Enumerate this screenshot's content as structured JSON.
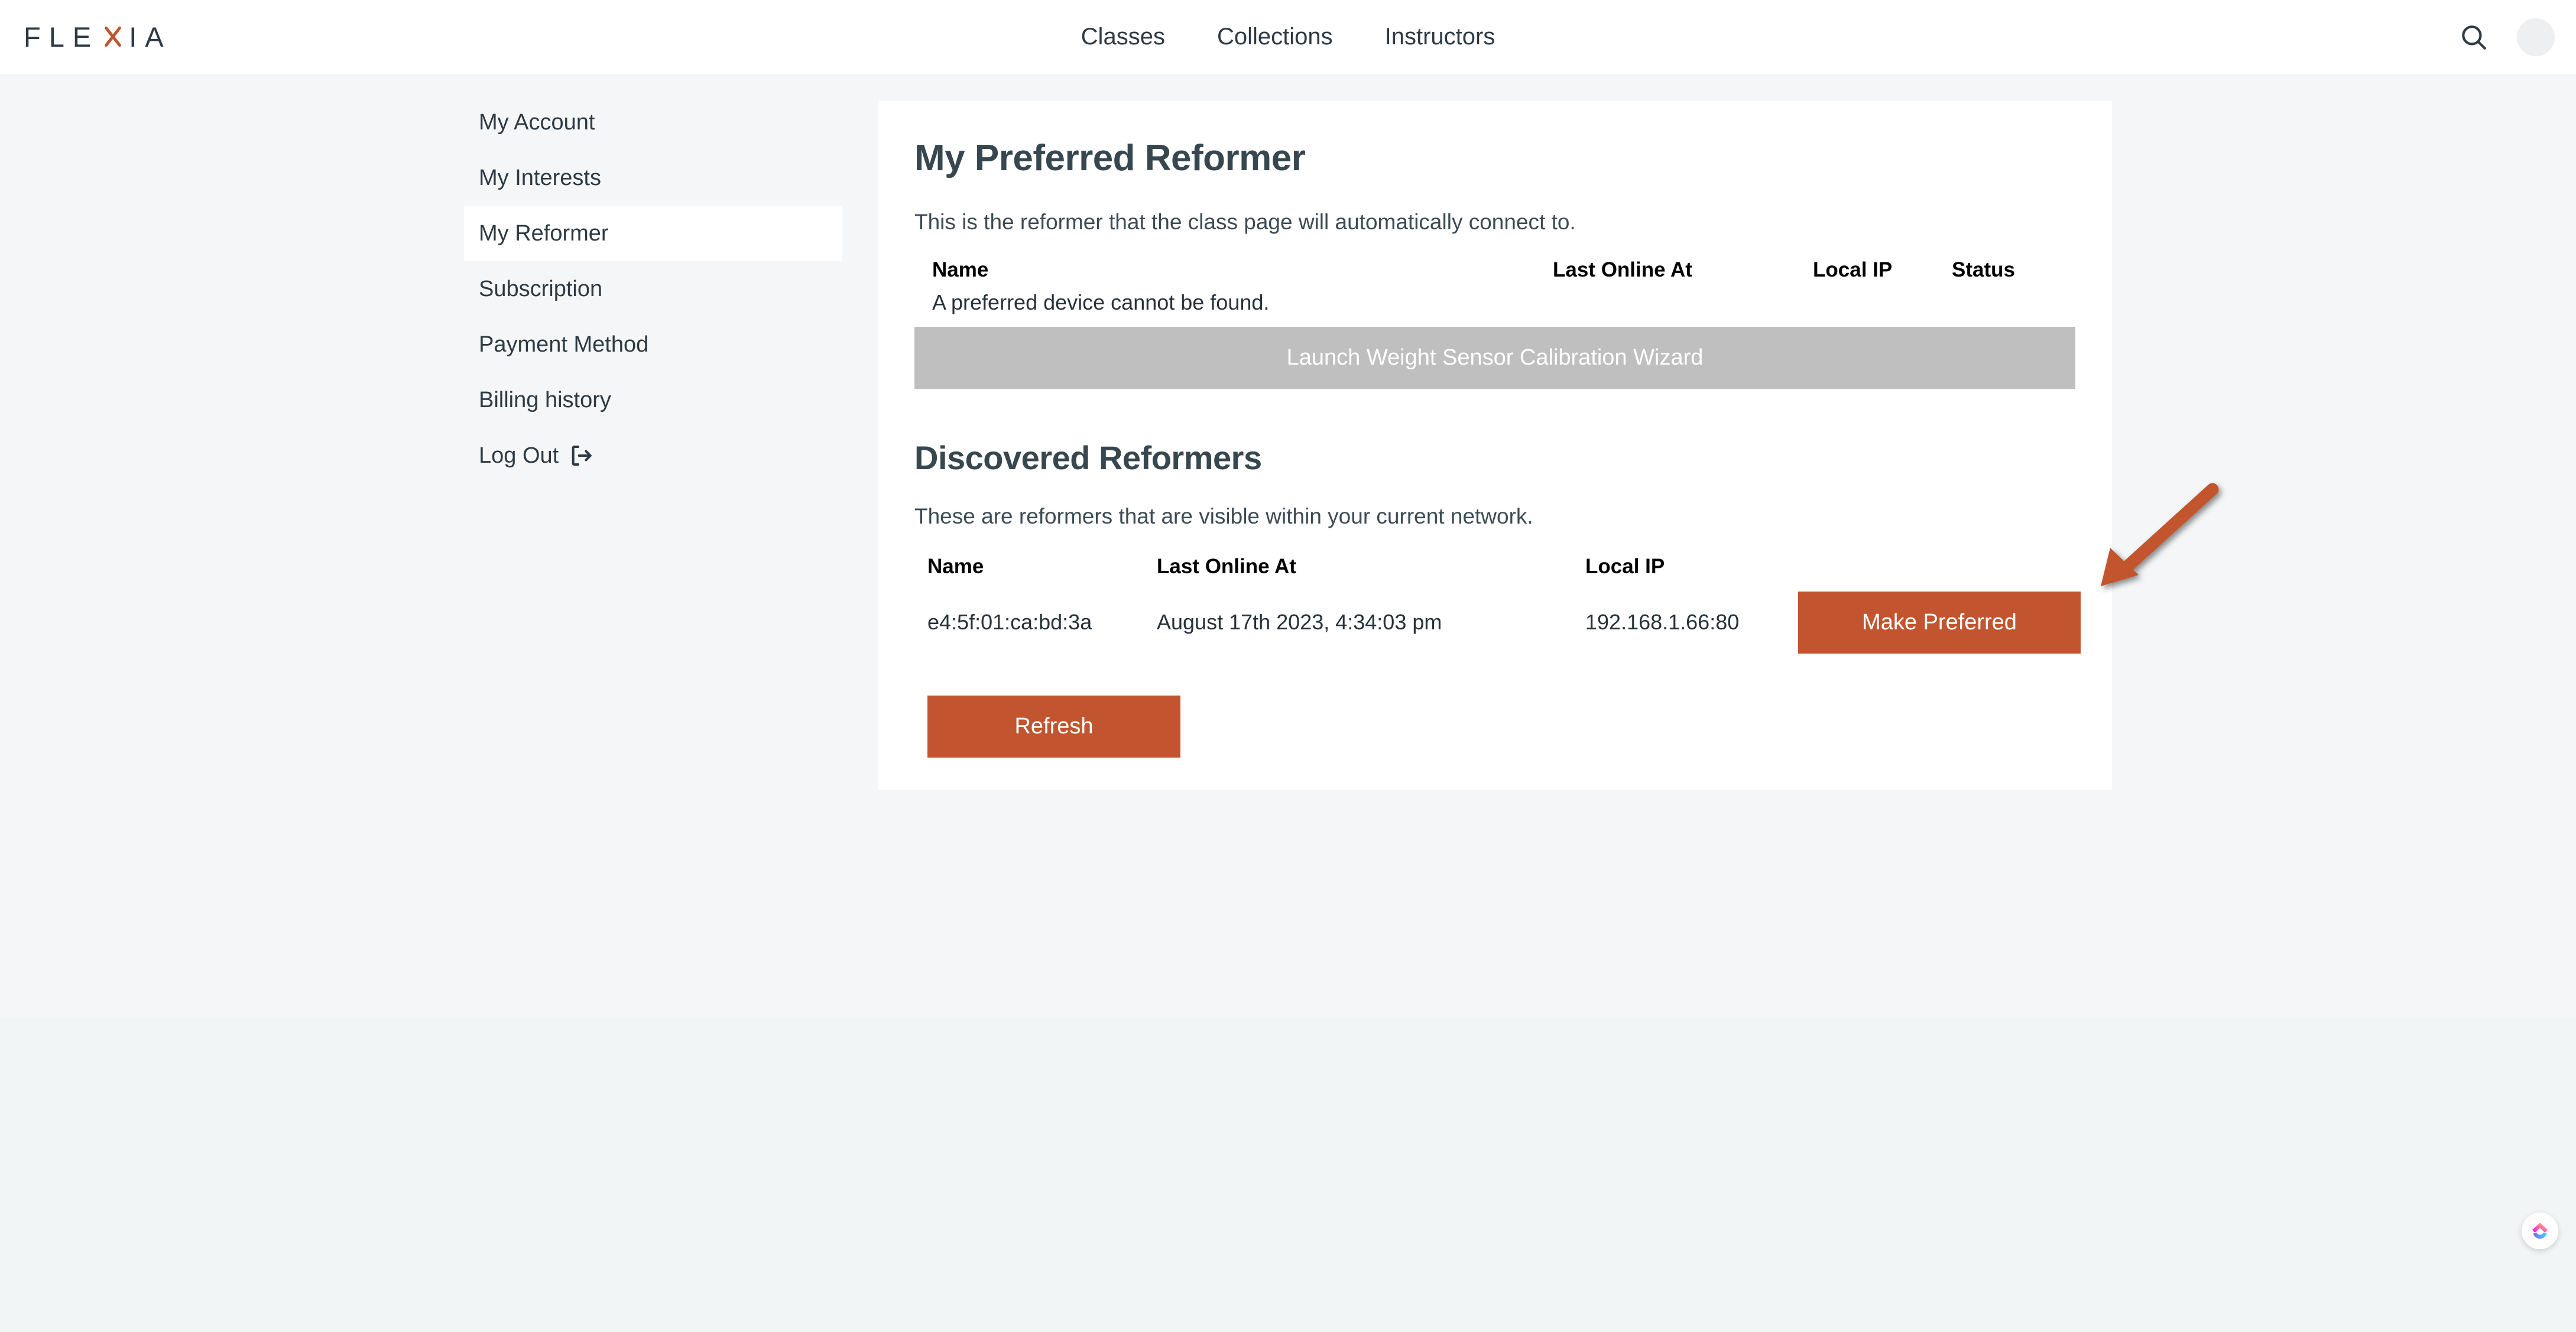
{
  "brand": {
    "name_before": "FLE",
    "name_x": "X",
    "name_after": "IA",
    "accent_color": "#c2552f"
  },
  "header": {
    "nav": [
      {
        "label": "Classes"
      },
      {
        "label": "Collections"
      },
      {
        "label": "Instructors"
      }
    ],
    "search_icon": "search-icon",
    "avatar_icon": "avatar"
  },
  "sidebar": {
    "items": [
      {
        "label": "My Account",
        "active": false
      },
      {
        "label": "My Interests",
        "active": false
      },
      {
        "label": "My Reformer",
        "active": true
      },
      {
        "label": "Subscription",
        "active": false
      },
      {
        "label": "Payment Method",
        "active": false
      },
      {
        "label": "Billing history",
        "active": false
      },
      {
        "label": "Log Out",
        "active": false,
        "icon": "logout-icon"
      }
    ]
  },
  "preferred": {
    "title": "My Preferred Reformer",
    "description": "This is the reformer that the class page will automatically connect to.",
    "columns": [
      "Name",
      "Last Online At",
      "Local IP",
      "Status"
    ],
    "empty_message": "A preferred device cannot be found.",
    "wizard_button": "Launch Weight Sensor Calibration Wizard",
    "wizard_button_disabled": true,
    "wizard_button_color": "#bfbfbf"
  },
  "discovered": {
    "title": "Discovered Reformers",
    "description": "These are reformers that are visible within your current network.",
    "columns": [
      "Name",
      "Last Online At",
      "Local IP",
      ""
    ],
    "rows": [
      {
        "name": "e4:5f:01:ca:bd:3a",
        "last_online_at": "August 17th 2023, 4:34:03 pm",
        "local_ip": "192.168.1.66:80",
        "action_label": "Make Preferred"
      }
    ],
    "refresh_button": "Refresh",
    "button_color": "#c2552f"
  },
  "annotation": {
    "type": "arrow",
    "color": "#c2552f",
    "points_to": "Make Preferred"
  },
  "widget": {
    "name": "clickup-widget",
    "colors": [
      "#ff02f0",
      "#fd71af",
      "#ffc800",
      "#7b68ee",
      "#49ccf9"
    ]
  }
}
